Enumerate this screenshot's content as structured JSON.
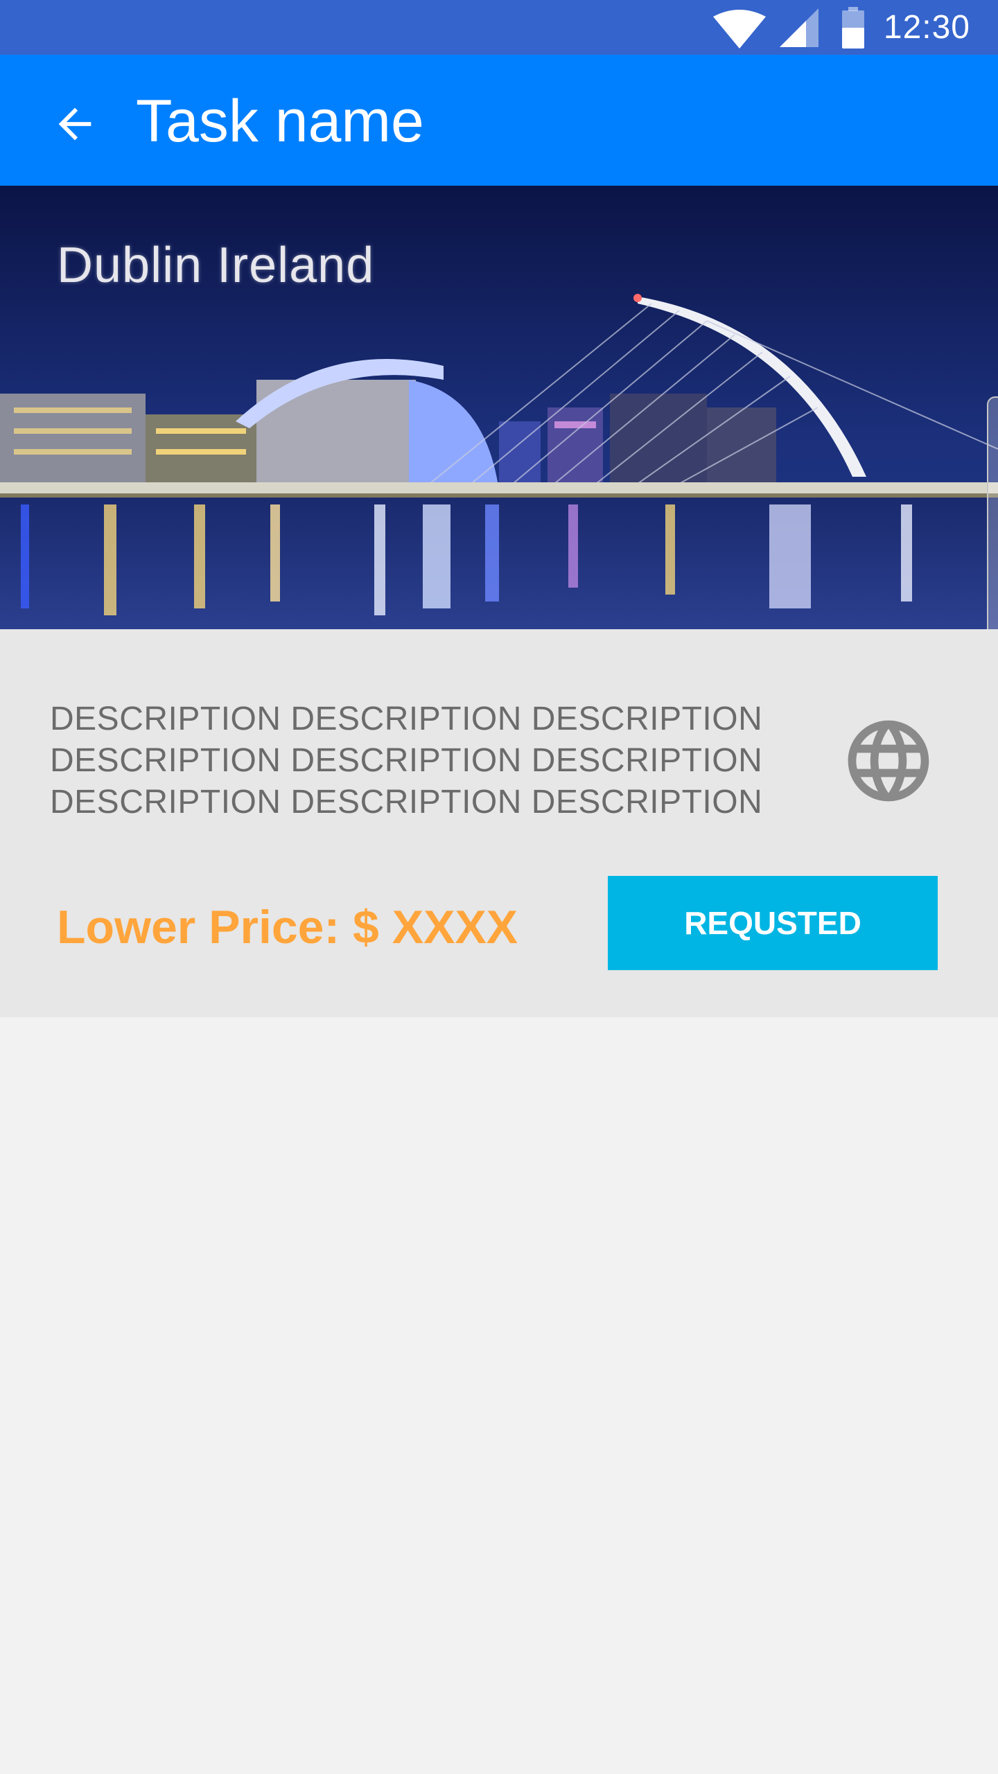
{
  "status_bar": {
    "time": "12:30",
    "icons": [
      "wifi-icon",
      "cell-signal-icon",
      "battery-icon"
    ]
  },
  "app_bar": {
    "back_icon": "arrow-back-icon",
    "title": "Task name"
  },
  "hero": {
    "caption": "Dublin Ireland"
  },
  "task": {
    "description": "DESCRIPTION DESCRIPTION DESCRIPTION DESCRIPTION DESCRIPTION DESCRIPTION DESCRIPTION DESCRIPTION DESCRIPTION",
    "globe_icon": "globe-icon",
    "price_label": "Lower Price: $ XXXX",
    "button_label": "REQUSTED"
  },
  "colors": {
    "status_bar": "#3564cc",
    "app_bar": "#0080ff",
    "card_background": "#e7e7e7",
    "page_background": "#f2f2f2",
    "price_text": "#ffa53c",
    "button": "#00b5e3",
    "description_text": "#6b6b6b"
  }
}
